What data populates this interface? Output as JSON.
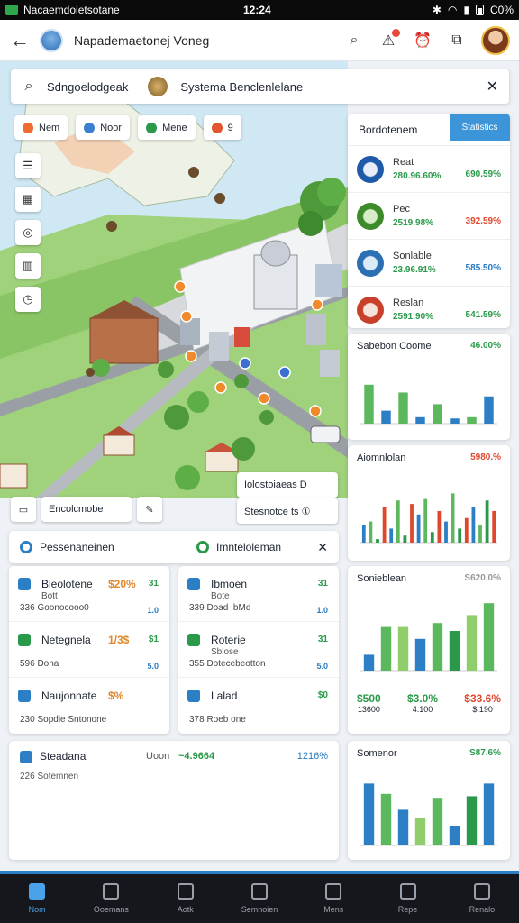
{
  "status_bar": {
    "title": "Nacaemdoietsotane",
    "time": "12:24",
    "battery": "C0%"
  },
  "app_bar": {
    "title": "Napademaetonej Voneg"
  },
  "search": {
    "left_text": "Sdngoelodgeak",
    "right_text": "Systema Benclenlelane"
  },
  "chips": [
    "Nem",
    "Noor",
    "Mene",
    "9"
  ],
  "map_buttons": {
    "left_label": "Encolcmobe",
    "right_top": "Iolostoiaeas D",
    "right_bottom": "Stesnotce ts ①"
  },
  "right_panel": {
    "title": "Bordotenem",
    "button": "Statistics",
    "metrics": [
      {
        "label": "Reat",
        "sub": "280.96.60%",
        "value": "690.59%",
        "color": "#2a9a4a"
      },
      {
        "label": "Pec",
        "sub": "2519.98%",
        "value": "392.59%",
        "color": "#e0482e"
      },
      {
        "label": "Sonlable",
        "sub": "23.96.91%",
        "value": "585.50%",
        "color": "#2a7ac0"
      },
      {
        "label": "Reslan",
        "sub": "2591.90%",
        "value": "541.59%",
        "color": "#2a9a4a"
      }
    ]
  },
  "charts": {
    "chart1": {
      "title": "Sabebon Coome",
      "value": "46.00%"
    },
    "chart2": {
      "title": "Aiomnlolan",
      "value": "5980.%"
    },
    "chart3": {
      "title": "Sonieblean",
      "value": "S620.0%",
      "stats": [
        {
          "v": "$500",
          "s": "13600"
        },
        {
          "v": "$3.0%",
          "s": "4.100"
        },
        {
          "v": "$33.6%",
          "s": "$.190"
        }
      ]
    },
    "chart4": {
      "title": "Somenor",
      "value": "S87.6%"
    }
  },
  "panel_header": {
    "left": "Pessenaneinen",
    "right": "Imnteloleman"
  },
  "list_left": [
    {
      "title": "Bleolotene",
      "sub": "Bott",
      "meta": "336  Goonocooo0",
      "num": "$20%",
      "n1": "31",
      "n2": "1.0"
    },
    {
      "title": "Netegnela",
      "sub": "",
      "meta": "596  Dona",
      "num": "1/3$",
      "n1": "$1",
      "n2": "5.0"
    },
    {
      "title": "Naujonnate",
      "sub": "",
      "meta": "230  Sopdie Sntonone",
      "num": "$%",
      "n1": "",
      "n2": ""
    }
  ],
  "list_right": [
    {
      "title": "Ibmoen",
      "sub": "Bote",
      "meta": "339  Doad IbMd",
      "n1": "31",
      "n2": "1.0"
    },
    {
      "title": "Roterie",
      "sub": "Sblose",
      "meta": "355  Dotecebeotton",
      "n1": "31",
      "n2": "5.0"
    },
    {
      "title": "Lalad",
      "sub": "",
      "meta": "378  Roeb one",
      "n1": "$0",
      "n2": ""
    }
  ],
  "bottom_card": {
    "title": "Steadana",
    "mid": "Uoon",
    "delta": "~4.9664",
    "value": "1216%",
    "sub": "226 Sotemnen"
  },
  "nav": [
    "Nom",
    "Ooemans",
    "Aotk",
    "Semnoien",
    "Mens",
    "Repe",
    "Renalo"
  ],
  "chart_data": [
    {
      "type": "bar",
      "title": "Sabebon Coome",
      "categories": [
        "1",
        "2",
        "3",
        "4",
        "5",
        "6",
        "7",
        "8"
      ],
      "series": [
        {
          "values": [
            60,
            20,
            48,
            10,
            30,
            8,
            10,
            42
          ]
        }
      ]
    },
    {
      "type": "bar",
      "title": "Aiomnlolan",
      "series": [
        {
          "values": [
            25,
            30,
            5,
            50,
            20,
            60,
            10,
            55,
            40,
            62,
            15,
            45,
            30,
            70,
            20,
            35,
            50,
            25,
            60,
            45
          ]
        }
      ]
    },
    {
      "type": "bar",
      "title": "Sonieblean",
      "series": [
        {
          "values": [
            20,
            55,
            55,
            40,
            60,
            50,
            70,
            85
          ]
        }
      ]
    },
    {
      "type": "bar",
      "title": "Somenor",
      "series": [
        {
          "values": [
            78,
            65,
            45,
            35,
            60,
            25,
            62,
            78
          ]
        }
      ]
    }
  ]
}
